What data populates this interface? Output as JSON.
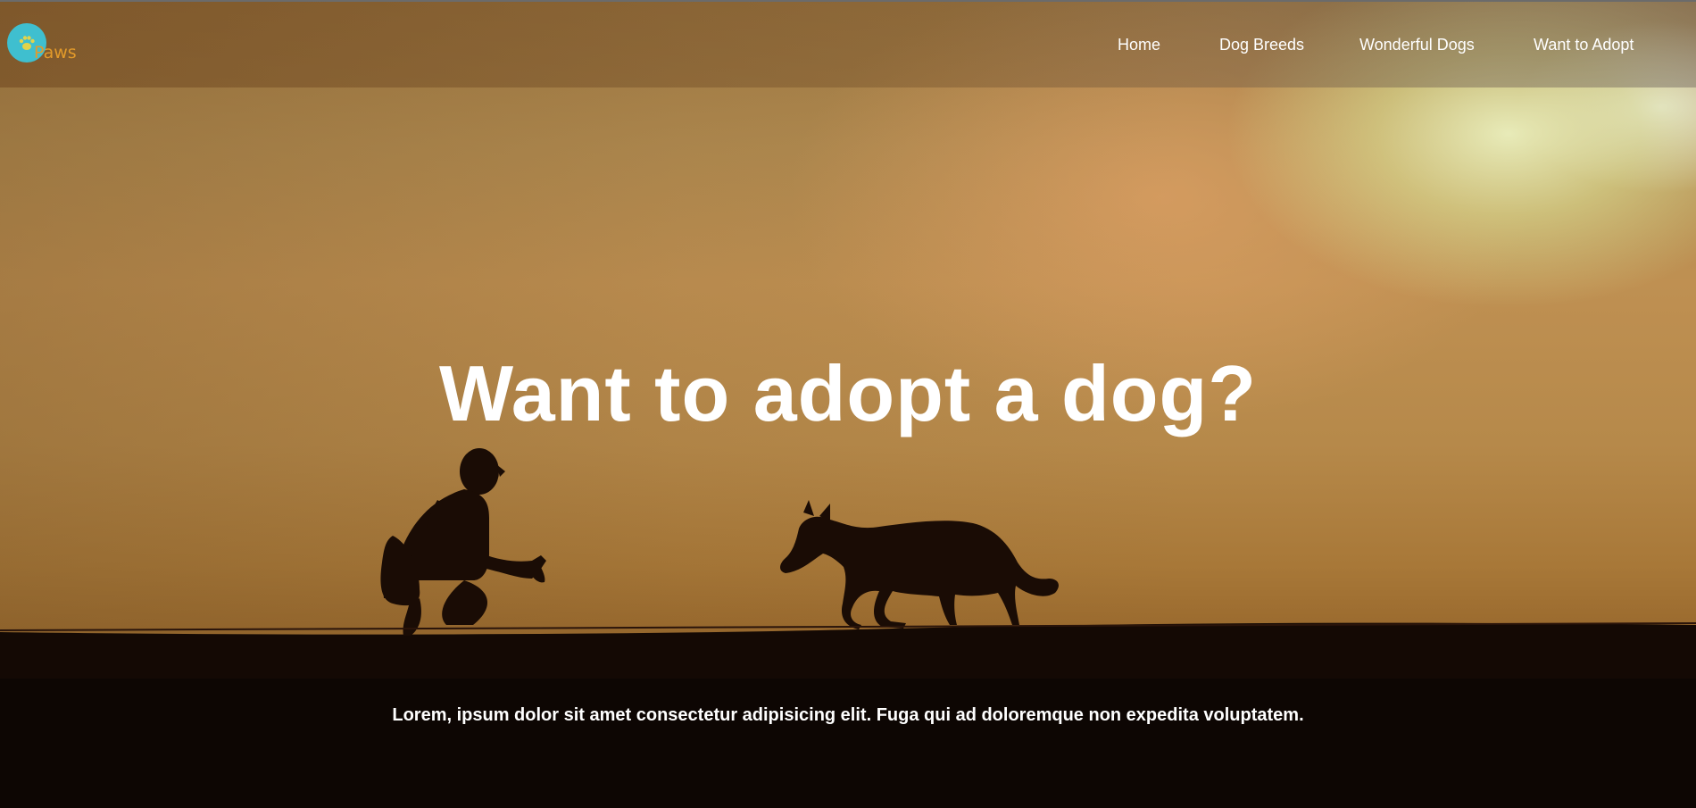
{
  "brand": {
    "logo_text": "Paws",
    "logo_icon": "paw-icon",
    "logo_color": "#3fbfcf",
    "logo_text_color": "#e39a2a"
  },
  "nav": {
    "items": [
      {
        "label": "Home"
      },
      {
        "label": "Dog Breeds"
      },
      {
        "label": "Wonderful Dogs"
      },
      {
        "label": "Want to Adopt"
      }
    ]
  },
  "hero": {
    "title": "Want to adopt a dog?",
    "subtitle": "Lorem, ipsum dolor sit amet consectetur adipisicing elit. Fuga qui ad doloremque non expedita voluptatem.",
    "image_icon": "sunset-silhouette-image"
  }
}
